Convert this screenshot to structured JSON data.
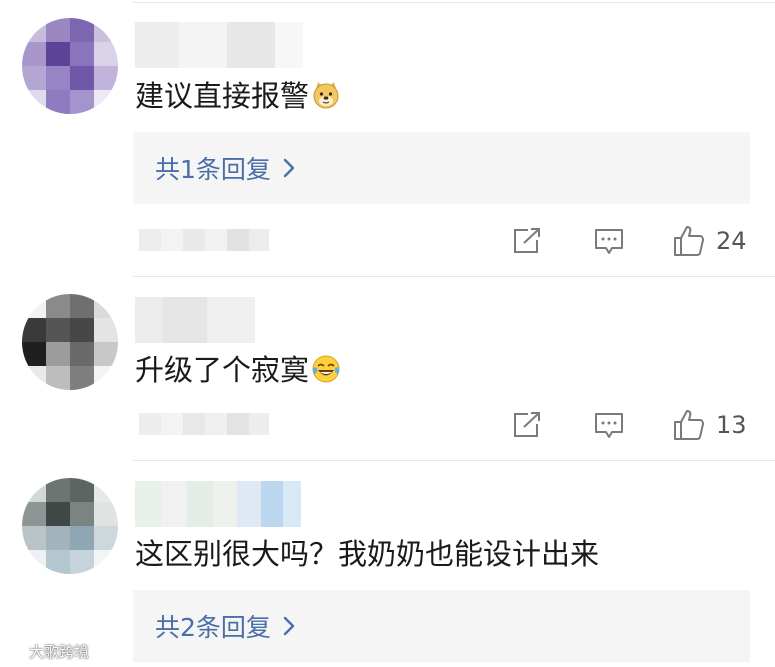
{
  "colors": {
    "link": "#4a6ea8",
    "reply_bg": "#f5f5f5",
    "separator": "#e8e8e8",
    "icon": "#7a7a7a"
  },
  "comments": [
    {
      "text": "建议直接报警",
      "emoji": "doge-emoji",
      "reply_link": "共1条回复",
      "likes": "24",
      "avatar_redacted": true,
      "username_redacted": true
    },
    {
      "text": "升级了个寂寞",
      "emoji": "laugh-cry-emoji",
      "reply_link": "",
      "likes": "13",
      "avatar_redacted": true,
      "username_redacted": true
    },
    {
      "text": "这区别很大吗？我奶奶也能设计出来",
      "emoji": "",
      "reply_link": "共2条回复",
      "likes": "",
      "avatar_redacted": true,
      "username_redacted": true
    }
  ],
  "icons": {
    "share": "share-icon",
    "comment": "comment-icon",
    "like": "thumb-up-icon",
    "chevron": "chevron-right-icon"
  },
  "watermark": "大歌跨境"
}
